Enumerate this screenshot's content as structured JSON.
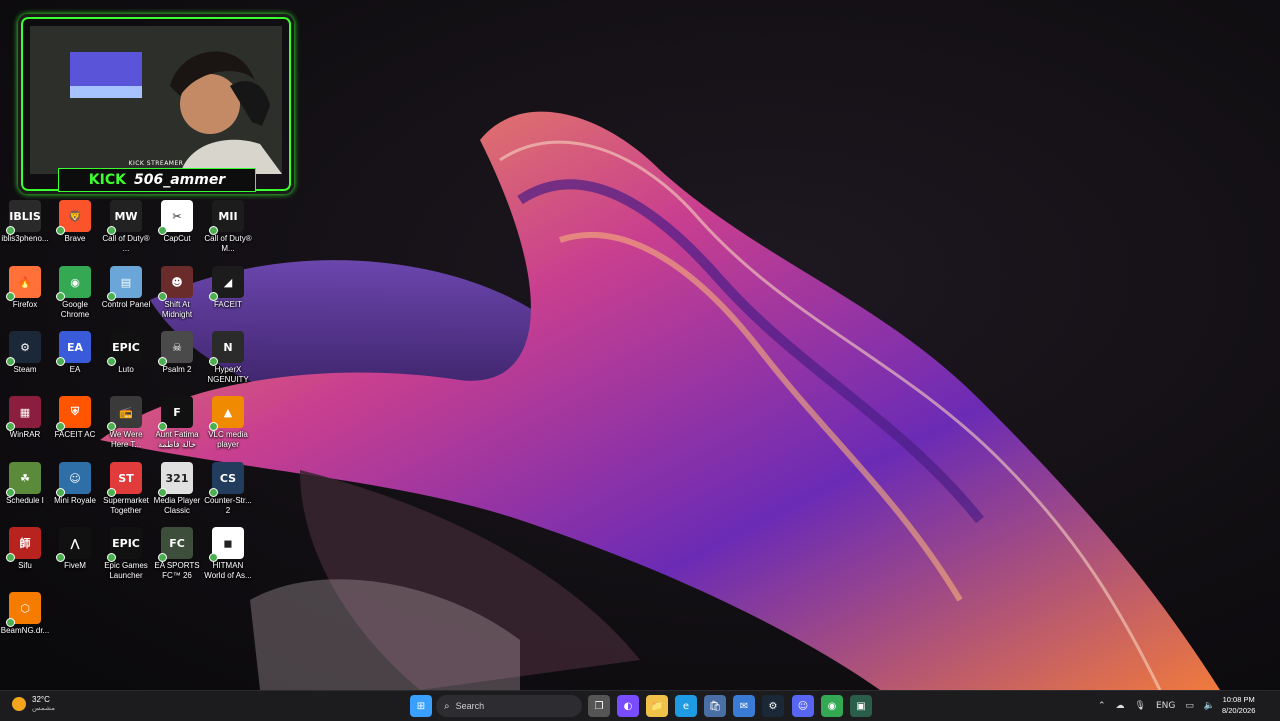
{
  "overlay": {
    "sub": "KICK STREAMER",
    "kick": "KICK",
    "name": "506_ammer"
  },
  "icons": [
    {
      "label": "iblis3pheno...",
      "icon": "iblis-game-icon",
      "color": "#2a2a2a",
      "glyph": "IBLIS"
    },
    {
      "label": "Brave",
      "icon": "brave-icon",
      "color": "#fb542b",
      "glyph": "🦁"
    },
    {
      "label": "Call of Duty® ...",
      "icon": "cod-mw-icon",
      "color": "#222222",
      "glyph": "MW"
    },
    {
      "label": "CapCut",
      "icon": "capcut-icon",
      "color": "#ffffff",
      "glyph": "✂"
    },
    {
      "label": "Call of Duty® M...",
      "icon": "cod-mwii-icon",
      "color": "#1c1c1c",
      "glyph": "MII"
    },
    {
      "label": "Firefox",
      "icon": "firefox-icon",
      "color": "#ff7139",
      "glyph": "🔥"
    },
    {
      "label": "Google Chrome",
      "icon": "chrome-icon",
      "color": "#34a853",
      "glyph": "◉"
    },
    {
      "label": "Control Panel",
      "icon": "control-panel-icon",
      "color": "#6aa7d8",
      "glyph": "▤"
    },
    {
      "label": "Shift At Midnight",
      "icon": "shift-at-midnight-icon",
      "color": "#6a2b2b",
      "glyph": "☻"
    },
    {
      "label": "FACEIT",
      "icon": "faceit-icon",
      "color": "#1c1c1c",
      "glyph": "◢"
    },
    {
      "label": "Steam",
      "icon": "steam-icon",
      "color": "#1b2838",
      "glyph": "⚙"
    },
    {
      "label": "EA",
      "icon": "ea-icon",
      "color": "#3a5bd9",
      "glyph": "EA"
    },
    {
      "label": "Luto",
      "icon": "luto-epic-icon",
      "color": "#111111",
      "glyph": "EPIC"
    },
    {
      "label": "Psalm 2",
      "icon": "psalm-2-icon",
      "color": "#4a4a4a",
      "glyph": "☠"
    },
    {
      "label": "HyperX NGENUITY",
      "icon": "hyperx-ngenuity-icon",
      "color": "#2b2b2b",
      "glyph": "N"
    },
    {
      "label": "WinRAR",
      "icon": "winrar-icon",
      "color": "#8b1e3f",
      "glyph": "▦"
    },
    {
      "label": "FACEIT AC",
      "icon": "faceit-ac-icon",
      "color": "#ff5500",
      "glyph": "⛨"
    },
    {
      "label": "We Were Here T...",
      "icon": "we-were-here-icon",
      "color": "#3a3a3a",
      "glyph": "📻"
    },
    {
      "label": "Aunt Fatima خالة فاطمة",
      "icon": "aunt-fatima-icon",
      "color": "#111111",
      "glyph": "F"
    },
    {
      "label": "VLC media player",
      "icon": "vlc-icon",
      "color": "#f08a00",
      "glyph": "▲"
    },
    {
      "label": "Schedule I",
      "icon": "schedule-i-icon",
      "color": "#5b8a3a",
      "glyph": "☘"
    },
    {
      "label": "Mini Royale",
      "icon": "mini-royale-icon",
      "color": "#2f6fa8",
      "glyph": "☺"
    },
    {
      "label": "Supermarket Together",
      "icon": "supermarket-together-icon",
      "color": "#e23b3b",
      "glyph": "ST"
    },
    {
      "label": "Media Player Classic",
      "icon": "media-player-classic-icon",
      "color": "#e0e0e0",
      "glyph": "321"
    },
    {
      "label": "Counter-Str... 2",
      "icon": "counter-strike-2-icon",
      "color": "#223c5e",
      "glyph": "CS"
    },
    {
      "label": "Sifu",
      "icon": "sifu-icon",
      "color": "#b8231f",
      "glyph": "師"
    },
    {
      "label": "FiveM",
      "icon": "fivem-icon",
      "color": "#111111",
      "glyph": "⋀"
    },
    {
      "label": "Epic Games Launcher",
      "icon": "epic-games-icon",
      "color": "#111111",
      "glyph": "EPIC"
    },
    {
      "label": "EA SPORTS FC™ 26",
      "icon": "ea-sports-fc-icon",
      "color": "#3d4f3a",
      "glyph": "FC"
    },
    {
      "label": "HITMAN World of As...",
      "icon": "hitman-icon",
      "color": "#ffffff",
      "glyph": "◼"
    },
    {
      "label": "BeamNG.dr...",
      "icon": "beamng-icon",
      "color": "#f57c00",
      "glyph": "⬡"
    }
  ],
  "taskbar": {
    "weather_temp": "32°C",
    "weather_place": "مشمس",
    "search_placeholder": "Search",
    "apps": [
      {
        "name": "start-icon",
        "color": "#3aa0ff",
        "glyph": "⊞"
      },
      {
        "name": "task-view-icon",
        "color": "#555555",
        "glyph": "❐"
      },
      {
        "name": "widgets-icon",
        "color": "#7a4cff",
        "glyph": "◐"
      },
      {
        "name": "file-explorer-icon",
        "color": "#f0c24a",
        "glyph": "📁"
      },
      {
        "name": "edge-icon",
        "color": "#1e9be3",
        "glyph": "e"
      },
      {
        "name": "store-icon",
        "color": "#4a6fa5",
        "glyph": "🛍"
      },
      {
        "name": "mail-icon",
        "color": "#3a7bd5",
        "glyph": "✉"
      },
      {
        "name": "steam-taskbar-icon",
        "color": "#1b2838",
        "glyph": "⚙"
      },
      {
        "name": "discord-icon",
        "color": "#5865f2",
        "glyph": "☺"
      },
      {
        "name": "chrome-taskbar-icon",
        "color": "#34a853",
        "glyph": "◉"
      },
      {
        "name": "app-taskbar-icon",
        "color": "#2b5e4a",
        "glyph": "▣"
      }
    ],
    "lang": "ENG",
    "time": "10:08 PM",
    "date": "8/20/2026"
  }
}
